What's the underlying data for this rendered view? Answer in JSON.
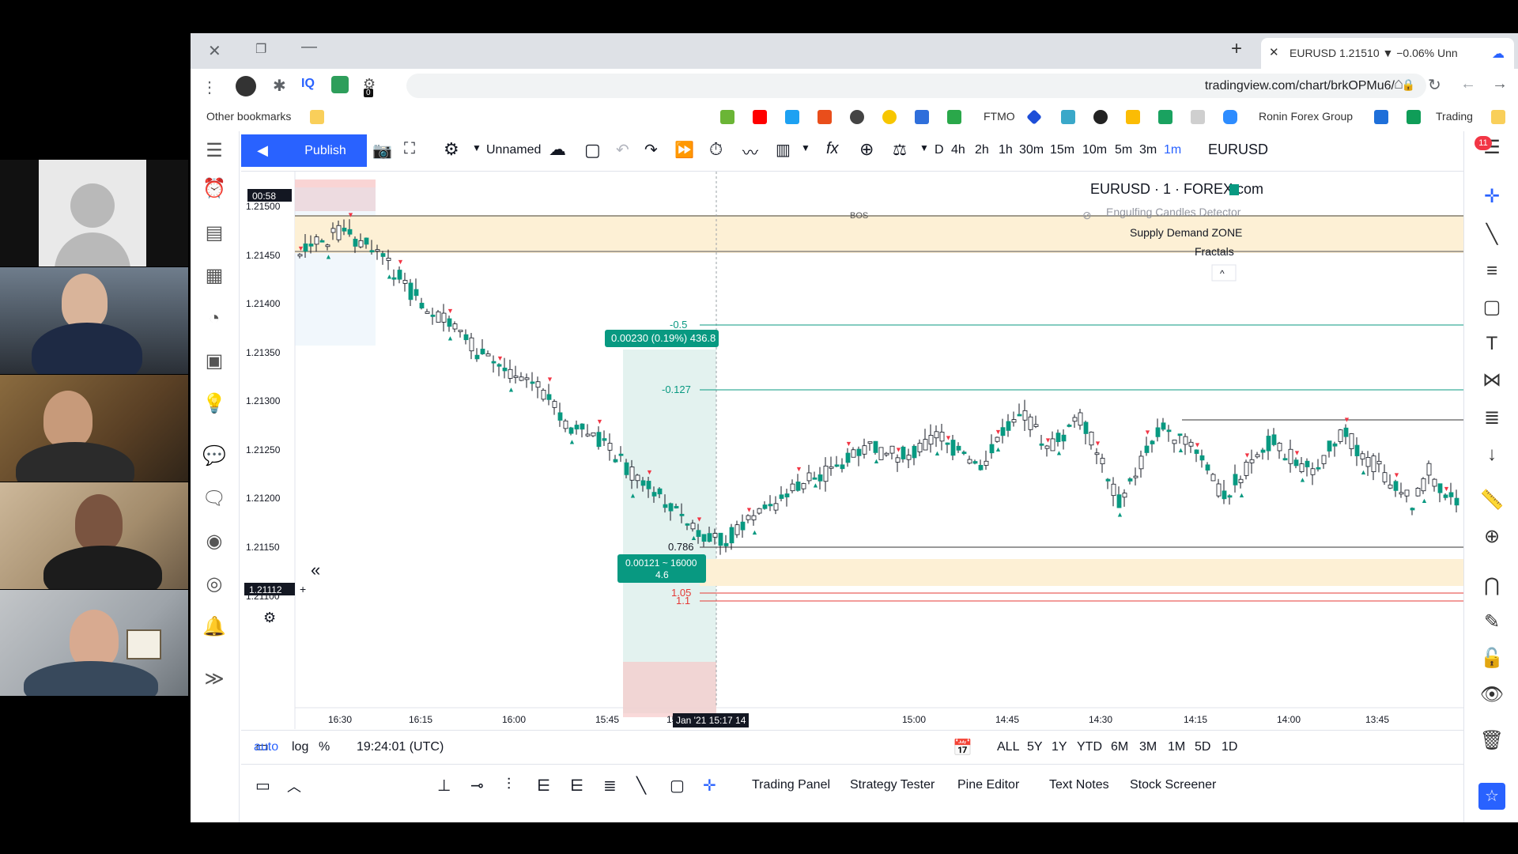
{
  "participants": {
    "tile0": "participant-avatar",
    "tile1": "participant-1",
    "tile2": "participant-2",
    "tile3": "participant-3",
    "tile4": "participant-4"
  },
  "browser": {
    "tab_title": "EURUSD 1.21510 ▼ −0.06% Unn",
    "url": "tradingview.com/chart/brkOPMu6/",
    "extension_badge": "0",
    "bookmarks": [
      "Trading",
      "Ronin Forex Group",
      "FTMO"
    ],
    "other_bookmarks": "Other bookmarks"
  },
  "toolbar": {
    "symbol": "EURUSD",
    "alert_count": "11",
    "timeframes": [
      "1m",
      "3m",
      "5m",
      "10m",
      "15m",
      "30m",
      "1h",
      "2h",
      "4h",
      "D"
    ],
    "active_timeframe": "1m",
    "layout_name": "Unnamed",
    "publish": "Publish"
  },
  "chart": {
    "title": "EURUSD · 1 · FOREX.com",
    "indicators": [
      "Engulfing Candles Detector",
      "Supply Demand ZONE",
      "Fractals"
    ],
    "bos_label": "BOS",
    "current_time_label": "00:58",
    "current_price": "1.21112",
    "price_ticks": [
      "1.21500",
      "1.21450",
      "1.21400",
      "1.21350",
      "1.21300",
      "1.21250",
      "1.21200",
      "1.21150",
      "1.21100"
    ],
    "time_ticks": [
      "16:30",
      "16:15",
      "16:00",
      "15:45",
      "15:30",
      "15:00",
      "14:45",
      "14:30",
      "14:15",
      "14:00",
      "13:45"
    ],
    "cursor_time": "Jan '21 15:17 14",
    "fib_levels": [
      "-0.5",
      "-0.127",
      "0.786",
      "1.05",
      "1.1"
    ],
    "measure_top": "0.00230 (0.19%) 436.8",
    "measure_bottom_1": "0.00121 ~ 16000",
    "measure_bottom_2": "4.6"
  },
  "bottom_bar": {
    "ranges": [
      "1D",
      "5D",
      "1M",
      "3M",
      "6M",
      "YTD",
      "1Y",
      "5Y",
      "ALL"
    ],
    "clock": "19:24:01 (UTC)",
    "percent": "%",
    "log": "log",
    "auto": "auto"
  },
  "bottom_tabs": [
    "Stock Screener",
    "Text Notes",
    "Pine Editor",
    "Strategy Tester",
    "Trading Panel"
  ]
}
